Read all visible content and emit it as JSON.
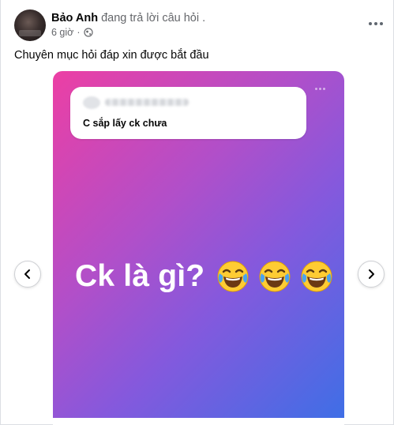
{
  "post": {
    "author_name": "Bảo Anh",
    "activity": "đang trả lời câu hỏi .",
    "timestamp": "6 giờ",
    "privacy_icon": "globe-icon",
    "more_icon": "ellipsis-icon",
    "caption": "Chuyên mục hỏi đáp xin được bắt đầu"
  },
  "card": {
    "question_text": "C sắp lấy ck chưa",
    "answer_text": "Ck là gì?",
    "emojis": [
      "😂",
      "😂",
      "😂"
    ],
    "gradient_colors": [
      "#ec3fa4",
      "#b14fc9",
      "#8459dd",
      "#3d6fe6"
    ]
  },
  "carousel": {
    "prev_icon": "chevron-left-icon",
    "next_icon": "chevron-right-icon"
  }
}
